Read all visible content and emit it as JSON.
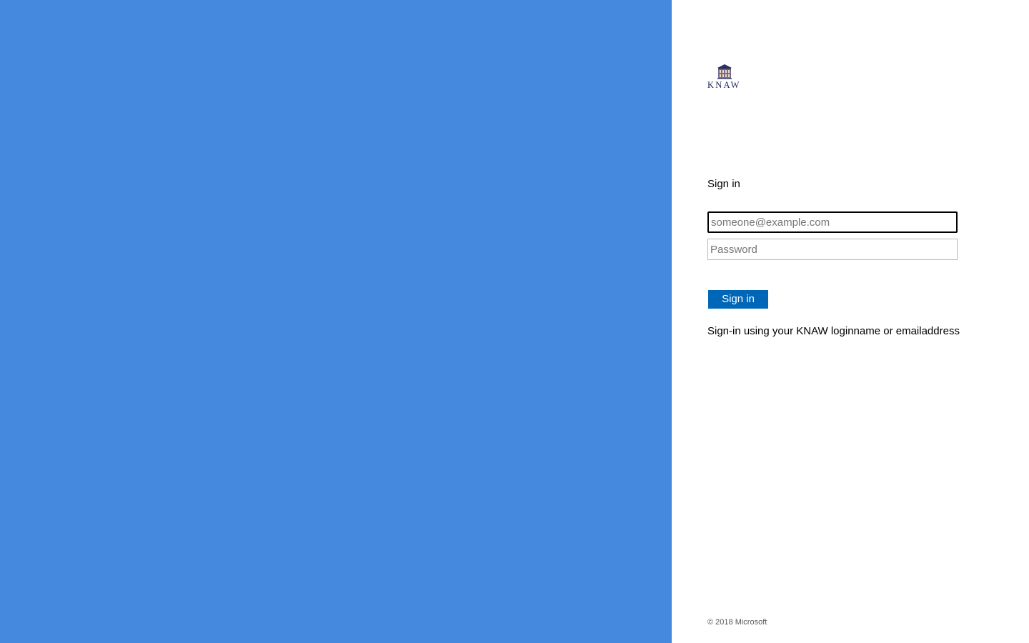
{
  "brand": {
    "logo_text": "KNAW",
    "illustration_color": "#4589de"
  },
  "form": {
    "heading": "Sign in",
    "username_placeholder": "someone@example.com",
    "username_value": "",
    "password_placeholder": "Password",
    "password_value": "",
    "submit_label": "Sign in",
    "submit_color": "#0067b8"
  },
  "intro_text": "Sign-in using your KNAW loginname or emailaddress",
  "footer": {
    "copyright": "© 2018 Microsoft"
  }
}
